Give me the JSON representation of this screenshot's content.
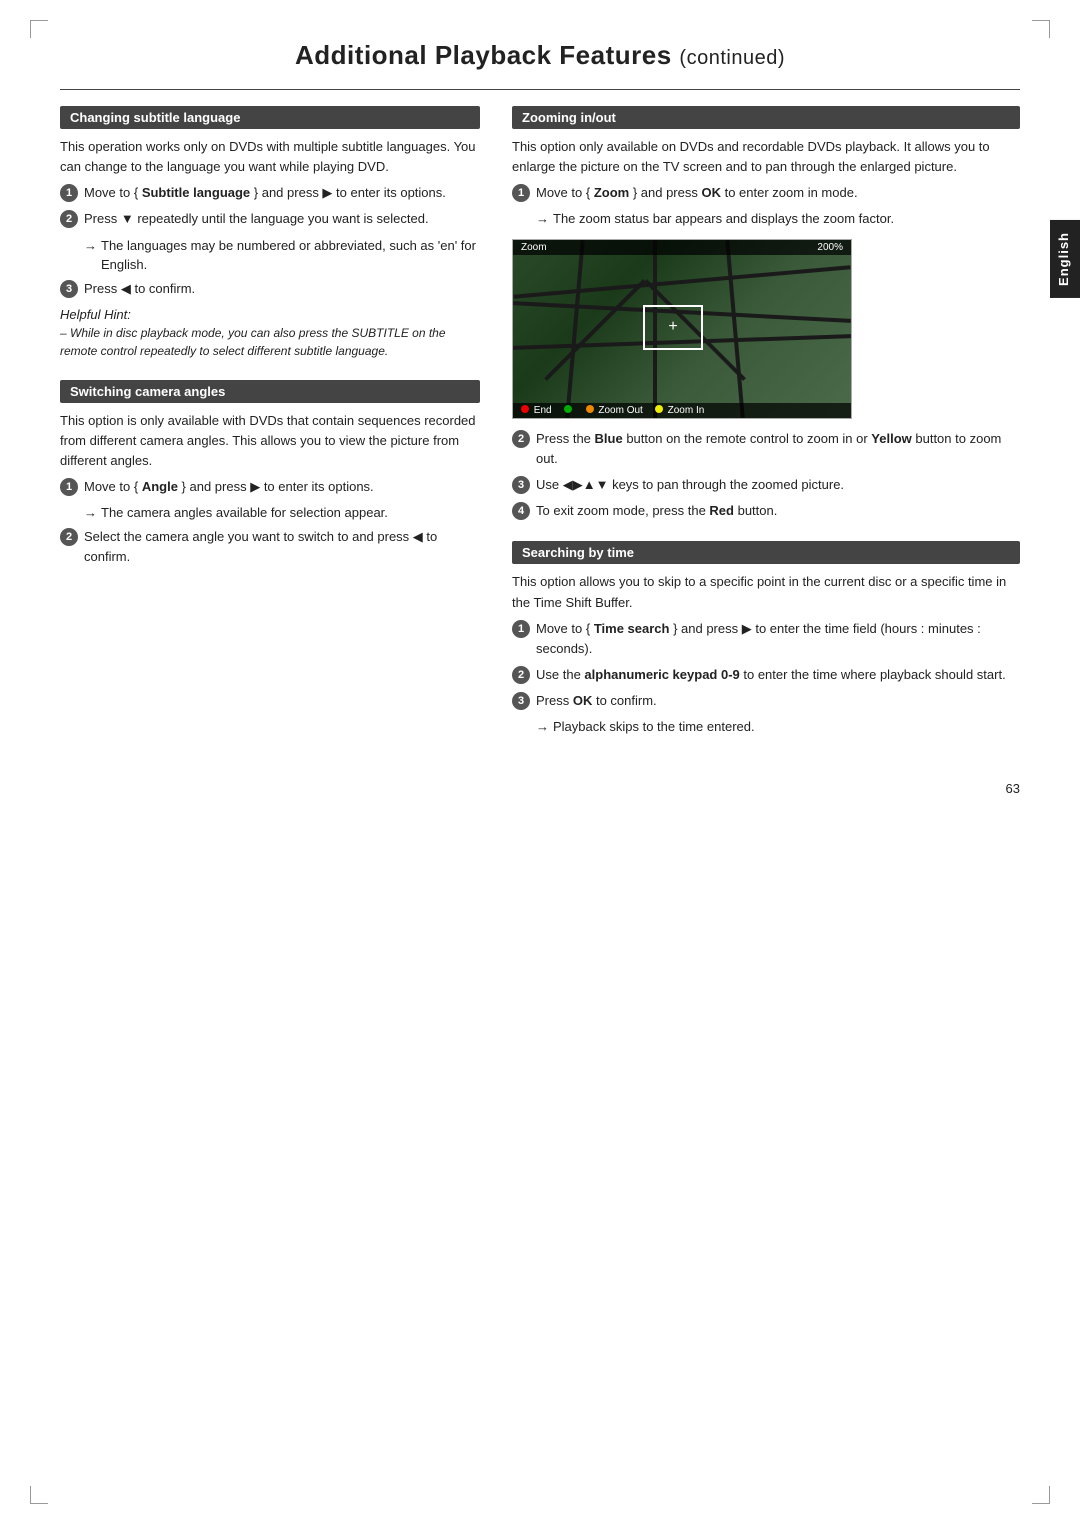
{
  "page": {
    "title": "Additional Playback Features",
    "title_continued": "(continued)",
    "page_number": "63",
    "english_tab": "English"
  },
  "left_column": {
    "subtitle_section": {
      "header": "Changing subtitle language",
      "intro": "This operation works only on DVDs with multiple subtitle languages. You can change to the language you want while playing DVD.",
      "steps": [
        {
          "num": "1",
          "text_before": "Move to { ",
          "bold": "Subtitle language",
          "text_after": " } and press ▶ to enter its options."
        },
        {
          "num": "2",
          "text": "Press ▼ repeatedly until the language you want is selected.",
          "arrow_notes": [
            "The languages may be numbered or abbreviated, such as 'en' for English."
          ]
        },
        {
          "num": "3",
          "text": "Press ◀ to confirm."
        }
      ],
      "helpful_hint_title": "Helpful Hint:",
      "helpful_hint_body": "– While in disc playback mode, you can also press the SUBTITLE on the remote control repeatedly to select different subtitle language."
    },
    "switching_section": {
      "header": "Switching camera angles",
      "intro": "This option is only available with DVDs that contain sequences recorded from different camera angles. This allows you to view the picture from different angles.",
      "steps": [
        {
          "num": "1",
          "text_before": "Move to { ",
          "bold": "Angle",
          "text_after": " } and press ▶ to enter its options.",
          "arrow_notes": [
            "The camera angles available for selection appear."
          ]
        },
        {
          "num": "2",
          "text": "Select the camera angle you want to switch to and press ◀ to confirm."
        }
      ]
    }
  },
  "right_column": {
    "zooming_section": {
      "header": "Zooming in/out",
      "intro": "This option only available on DVDs and recordable DVDs playback.  It allows you to enlarge the picture on the TV screen and to pan through the enlarged picture.",
      "steps": [
        {
          "num": "1",
          "text_before": "Move to { ",
          "bold": "Zoom",
          "text_after": " } and press OK to enter zoom in mode.",
          "arrow_notes": [
            "The zoom status bar appears and displays the zoom factor."
          ]
        }
      ],
      "zoom_image": {
        "label_left": "Zoom",
        "label_right": "200%",
        "controls": [
          {
            "dot": "red",
            "label": "End"
          },
          {
            "dot": "green",
            "label": ""
          },
          {
            "dot": "orange",
            "label": "Zoom Out"
          },
          {
            "dot": "yellow",
            "label": "Zoom In"
          }
        ]
      },
      "steps2": [
        {
          "num": "2",
          "text_before": "Press the ",
          "bold1": "Blue",
          "text_mid": " button on the remote control to zoom in or ",
          "bold2": "Yellow",
          "text_after": " button to zoom out."
        },
        {
          "num": "3",
          "text_before": "Use ◀▶▲▼ keys to pan through the zoomed picture."
        },
        {
          "num": "4",
          "text_before": "To exit zoom mode, press the ",
          "bold": "Red",
          "text_after": " button."
        }
      ]
    },
    "searching_section": {
      "header": "Searching by time",
      "intro": "This option allows you to skip to a specific point in the current disc or a specific time in the Time Shift Buffer.",
      "steps": [
        {
          "num": "1",
          "text_before": "Move to { ",
          "bold": "Time search",
          "text_after": " } and press ▶ to enter the time field (hours : minutes : seconds)."
        },
        {
          "num": "2",
          "text_before": "Use the ",
          "bold": "alphanumeric keypad 0-9",
          "text_after": " to enter the time where playback should start."
        },
        {
          "num": "3",
          "text_before": "Press ",
          "bold": "OK",
          "text_after": " to confirm.",
          "arrow_notes": [
            "Playback skips to the time entered."
          ]
        }
      ]
    }
  }
}
